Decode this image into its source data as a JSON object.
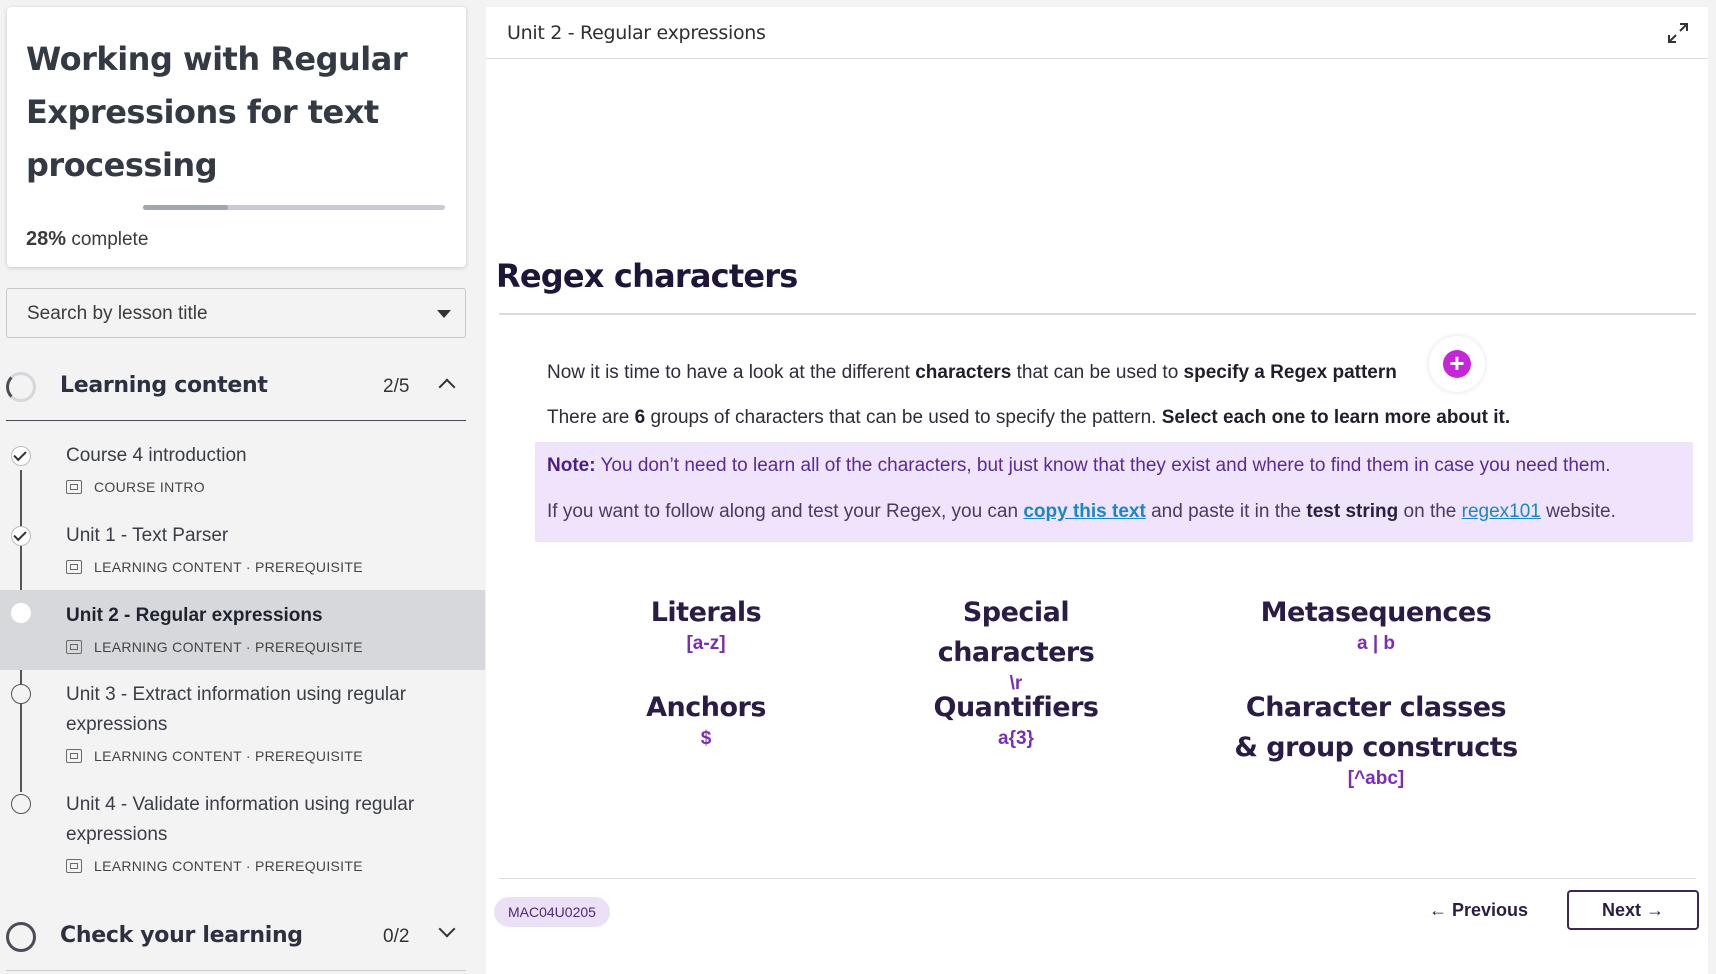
{
  "course": {
    "title": "Working with Regular Expressions for text processing",
    "progress_percent": "28%",
    "progress_suffix": "complete",
    "progress_fraction": 0.28
  },
  "search": {
    "placeholder": "Search by lesson title"
  },
  "sections": [
    {
      "label": "Learning content",
      "count": "2/5",
      "expanded": true
    },
    {
      "label": "Check your learning",
      "count": "0/2",
      "expanded": false
    }
  ],
  "lessons": [
    {
      "title": "Course 4 introduction",
      "meta": "COURSE INTRO",
      "status": "completed"
    },
    {
      "title": "Unit 1 - Text Parser",
      "meta": "LEARNING CONTENT · PREREQUISITE",
      "status": "completed"
    },
    {
      "title": "Unit 2 - Regular expressions",
      "meta": "LEARNING CONTENT · PREREQUISITE",
      "status": "current"
    },
    {
      "title": "Unit 3 - Extract information using regular expressions",
      "meta": "LEARNING CONTENT · PREREQUISITE",
      "status": "not-started"
    },
    {
      "title": "Unit 4 - Validate information using regular expressions",
      "meta": "LEARNING CONTENT · PREREQUISITE",
      "status": "not-started"
    }
  ],
  "main": {
    "breadcrumb": "Unit 2 - Regular expressions",
    "heading": "Regex characters",
    "para1": {
      "a": "Now it is time to have a look at the different ",
      "b": "characters",
      "c": " that can be used to ",
      "d": "specify a Regex pattern"
    },
    "para2": {
      "a": "There are ",
      "b": "6",
      "c": " groups of characters that can be used to specify the pattern. ",
      "d": "Select each one to learn more about it."
    },
    "note": {
      "label": "Note:",
      "line1": " You don’t need to learn all of the characters, but just know that they exist and where to find them in case you need them.",
      "line2_a": "If you want to follow along and test your Regex, you can ",
      "link1": "copy this text",
      "line2_b": " and paste it in the ",
      "bold": "test string",
      "line2_c": " on the ",
      "link2": "regex101",
      "line2_d": " website."
    },
    "cards": [
      {
        "title": "Literals",
        "sample": "[a-z]"
      },
      {
        "title": "Special characters",
        "sample": "\\r"
      },
      {
        "title": "Metasequences",
        "sample": "a | b"
      },
      {
        "title": "Anchors",
        "sample": "$"
      },
      {
        "title": "Quantifiers",
        "sample": "a{3}"
      },
      {
        "title_l1": "Character classes",
        "title_l2": "& group constructs",
        "sample": "[^abc]"
      }
    ],
    "code": "MAC04U0205",
    "prev": "← Previous",
    "next": "Next →"
  },
  "colors": {
    "accent": "#c527d6",
    "note_bg": "#efe4fb",
    "heading": "#1e1638",
    "link": "#1a86c8"
  },
  "icons": [
    "expand-icon",
    "plus-icon",
    "checkmark-icon",
    "lesson-icon",
    "chevron-up-icon",
    "chevron-down-icon",
    "caret-down-icon"
  ]
}
